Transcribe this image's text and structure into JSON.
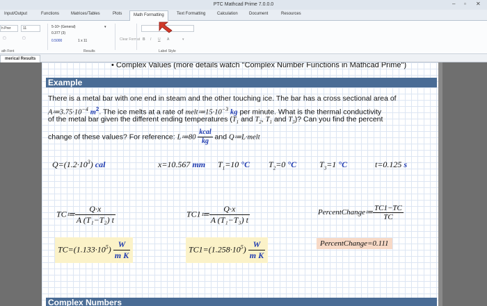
{
  "app": {
    "title": "PTC Mathcad Prime 7.0.0.0"
  },
  "tabs": [
    "Input/Output",
    "Functions",
    "Matrices/Tables",
    "Plots",
    "Math Formatting",
    "Text Formatting",
    "Calculation",
    "Document",
    "Resources"
  ],
  "active_tab": "Math Formatting",
  "ribbon": {
    "font_group": {
      "font": "h Prer",
      "size": "11",
      "label": "ath Font"
    },
    "results_group": {
      "general": "5-10⁵ (General)",
      "value1": "0.377 (3)",
      "value2": "0.5000",
      "unit": "1 x 11",
      "label": "Results"
    },
    "clear_format": "Clear Format",
    "label_group": {
      "label": "Label Style"
    }
  },
  "doc_tab": "merical Results",
  "page": {
    "bullet": "•   Complex Values (more details watch \"Complex Number Functions in Mathcad Prime\")",
    "heading1": "Example",
    "heading2": "Complex Numbers",
    "para": {
      "l1": "There is a metal bar with one end in steam and the other touching ice.  The bar has a cross sectional area of",
      "l2_var": "A",
      "l2_val": "3.75·10",
      "l2_exp": "−4",
      "l2_unit": "m",
      "l2_unit_exp": "2",
      "l2_text": ".  The ice melts at a rate of",
      "l2_var2": "melt",
      "l2_val2": "15·10",
      "l2_exp2": "−3",
      "l2_unit2": "kg",
      "l2_tail": "per minute.  What is the thermal conductivity",
      "l3": "of the metal bar given the different ending temperatures",
      "l3_tail": "?  Can you find the percent",
      "l4": "change of these values?  For reference:",
      "l4_L": "L",
      "l4_Lval": "80",
      "l4_Lnum": "kcal",
      "l4_Lden": "kg",
      "l4_and": "and",
      "l4_Q": "Q",
      "l4_Qexpr": "L·melt"
    },
    "results": {
      "Q": "Q=(1.2·10",
      "Q_exp": "3",
      "Q_unit": "cal",
      "x": "x=10.567",
      "x_unit": "mm",
      "T1": "T",
      "T1_val": "=10",
      "T2_val": "=0",
      "T3_val": "=1",
      "temp_unit": "°C",
      "t": "t=0.125",
      "t_unit": "s"
    },
    "formulas": {
      "TC_lhs": "TC",
      "TC_num": "Q·x",
      "TC_den": "A (T₁−T₂) t",
      "TC1_lhs": "TC1",
      "TC1_num": "Q·x",
      "TC1_den": "A (T₁−T₃) t",
      "PC_lhs": "PercentChange",
      "PC_num": "TC1−TC",
      "PC_den": "TC"
    },
    "answers": {
      "TC": "TC=(1.133·10",
      "TC_exp": "5",
      "TC1": "TC1=(1.258·10",
      "TC1_exp": "5",
      "unit_num": "W",
      "unit_den": "m K",
      "PC": "PercentChange=0.111"
    }
  },
  "colors": {
    "heading_bg": "#4a6c95",
    "unit_blue": "#1f3bb0",
    "highlight_yellow": "#fbf2c8",
    "highlight_red": "#f7d9c6",
    "arrow": "#d23a2a"
  }
}
